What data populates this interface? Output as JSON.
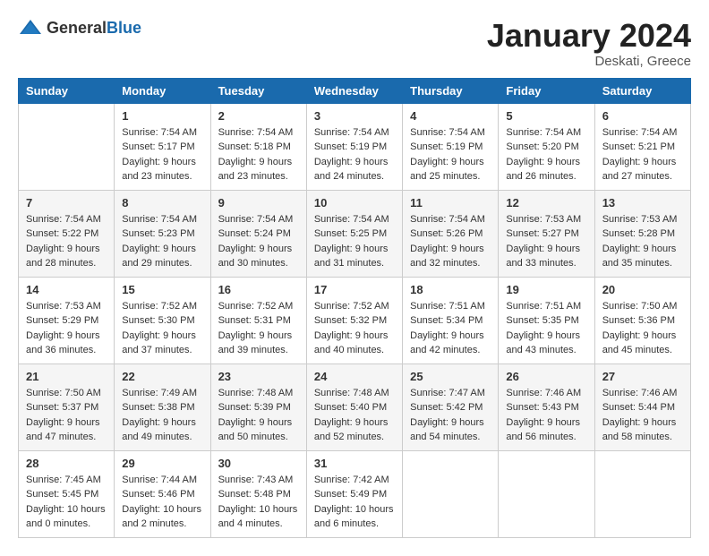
{
  "logo": {
    "general": "General",
    "blue": "Blue"
  },
  "header": {
    "month": "January 2024",
    "location": "Deskati, Greece"
  },
  "columns": [
    "Sunday",
    "Monday",
    "Tuesday",
    "Wednesday",
    "Thursday",
    "Friday",
    "Saturday"
  ],
  "weeks": [
    [
      {
        "day": "",
        "sunrise": "",
        "sunset": "",
        "daylight": ""
      },
      {
        "day": "1",
        "sunrise": "Sunrise: 7:54 AM",
        "sunset": "Sunset: 5:17 PM",
        "daylight": "Daylight: 9 hours and 23 minutes."
      },
      {
        "day": "2",
        "sunrise": "Sunrise: 7:54 AM",
        "sunset": "Sunset: 5:18 PM",
        "daylight": "Daylight: 9 hours and 23 minutes."
      },
      {
        "day": "3",
        "sunrise": "Sunrise: 7:54 AM",
        "sunset": "Sunset: 5:19 PM",
        "daylight": "Daylight: 9 hours and 24 minutes."
      },
      {
        "day": "4",
        "sunrise": "Sunrise: 7:54 AM",
        "sunset": "Sunset: 5:19 PM",
        "daylight": "Daylight: 9 hours and 25 minutes."
      },
      {
        "day": "5",
        "sunrise": "Sunrise: 7:54 AM",
        "sunset": "Sunset: 5:20 PM",
        "daylight": "Daylight: 9 hours and 26 minutes."
      },
      {
        "day": "6",
        "sunrise": "Sunrise: 7:54 AM",
        "sunset": "Sunset: 5:21 PM",
        "daylight": "Daylight: 9 hours and 27 minutes."
      }
    ],
    [
      {
        "day": "7",
        "sunrise": "Sunrise: 7:54 AM",
        "sunset": "Sunset: 5:22 PM",
        "daylight": "Daylight: 9 hours and 28 minutes."
      },
      {
        "day": "8",
        "sunrise": "Sunrise: 7:54 AM",
        "sunset": "Sunset: 5:23 PM",
        "daylight": "Daylight: 9 hours and 29 minutes."
      },
      {
        "day": "9",
        "sunrise": "Sunrise: 7:54 AM",
        "sunset": "Sunset: 5:24 PM",
        "daylight": "Daylight: 9 hours and 30 minutes."
      },
      {
        "day": "10",
        "sunrise": "Sunrise: 7:54 AM",
        "sunset": "Sunset: 5:25 PM",
        "daylight": "Daylight: 9 hours and 31 minutes."
      },
      {
        "day": "11",
        "sunrise": "Sunrise: 7:54 AM",
        "sunset": "Sunset: 5:26 PM",
        "daylight": "Daylight: 9 hours and 32 minutes."
      },
      {
        "day": "12",
        "sunrise": "Sunrise: 7:53 AM",
        "sunset": "Sunset: 5:27 PM",
        "daylight": "Daylight: 9 hours and 33 minutes."
      },
      {
        "day": "13",
        "sunrise": "Sunrise: 7:53 AM",
        "sunset": "Sunset: 5:28 PM",
        "daylight": "Daylight: 9 hours and 35 minutes."
      }
    ],
    [
      {
        "day": "14",
        "sunrise": "Sunrise: 7:53 AM",
        "sunset": "Sunset: 5:29 PM",
        "daylight": "Daylight: 9 hours and 36 minutes."
      },
      {
        "day": "15",
        "sunrise": "Sunrise: 7:52 AM",
        "sunset": "Sunset: 5:30 PM",
        "daylight": "Daylight: 9 hours and 37 minutes."
      },
      {
        "day": "16",
        "sunrise": "Sunrise: 7:52 AM",
        "sunset": "Sunset: 5:31 PM",
        "daylight": "Daylight: 9 hours and 39 minutes."
      },
      {
        "day": "17",
        "sunrise": "Sunrise: 7:52 AM",
        "sunset": "Sunset: 5:32 PM",
        "daylight": "Daylight: 9 hours and 40 minutes."
      },
      {
        "day": "18",
        "sunrise": "Sunrise: 7:51 AM",
        "sunset": "Sunset: 5:34 PM",
        "daylight": "Daylight: 9 hours and 42 minutes."
      },
      {
        "day": "19",
        "sunrise": "Sunrise: 7:51 AM",
        "sunset": "Sunset: 5:35 PM",
        "daylight": "Daylight: 9 hours and 43 minutes."
      },
      {
        "day": "20",
        "sunrise": "Sunrise: 7:50 AM",
        "sunset": "Sunset: 5:36 PM",
        "daylight": "Daylight: 9 hours and 45 minutes."
      }
    ],
    [
      {
        "day": "21",
        "sunrise": "Sunrise: 7:50 AM",
        "sunset": "Sunset: 5:37 PM",
        "daylight": "Daylight: 9 hours and 47 minutes."
      },
      {
        "day": "22",
        "sunrise": "Sunrise: 7:49 AM",
        "sunset": "Sunset: 5:38 PM",
        "daylight": "Daylight: 9 hours and 49 minutes."
      },
      {
        "day": "23",
        "sunrise": "Sunrise: 7:48 AM",
        "sunset": "Sunset: 5:39 PM",
        "daylight": "Daylight: 9 hours and 50 minutes."
      },
      {
        "day": "24",
        "sunrise": "Sunrise: 7:48 AM",
        "sunset": "Sunset: 5:40 PM",
        "daylight": "Daylight: 9 hours and 52 minutes."
      },
      {
        "day": "25",
        "sunrise": "Sunrise: 7:47 AM",
        "sunset": "Sunset: 5:42 PM",
        "daylight": "Daylight: 9 hours and 54 minutes."
      },
      {
        "day": "26",
        "sunrise": "Sunrise: 7:46 AM",
        "sunset": "Sunset: 5:43 PM",
        "daylight": "Daylight: 9 hours and 56 minutes."
      },
      {
        "day": "27",
        "sunrise": "Sunrise: 7:46 AM",
        "sunset": "Sunset: 5:44 PM",
        "daylight": "Daylight: 9 hours and 58 minutes."
      }
    ],
    [
      {
        "day": "28",
        "sunrise": "Sunrise: 7:45 AM",
        "sunset": "Sunset: 5:45 PM",
        "daylight": "Daylight: 10 hours and 0 minutes."
      },
      {
        "day": "29",
        "sunrise": "Sunrise: 7:44 AM",
        "sunset": "Sunset: 5:46 PM",
        "daylight": "Daylight: 10 hours and 2 minutes."
      },
      {
        "day": "30",
        "sunrise": "Sunrise: 7:43 AM",
        "sunset": "Sunset: 5:48 PM",
        "daylight": "Daylight: 10 hours and 4 minutes."
      },
      {
        "day": "31",
        "sunrise": "Sunrise: 7:42 AM",
        "sunset": "Sunset: 5:49 PM",
        "daylight": "Daylight: 10 hours and 6 minutes."
      },
      {
        "day": "",
        "sunrise": "",
        "sunset": "",
        "daylight": ""
      },
      {
        "day": "",
        "sunrise": "",
        "sunset": "",
        "daylight": ""
      },
      {
        "day": "",
        "sunrise": "",
        "sunset": "",
        "daylight": ""
      }
    ]
  ]
}
